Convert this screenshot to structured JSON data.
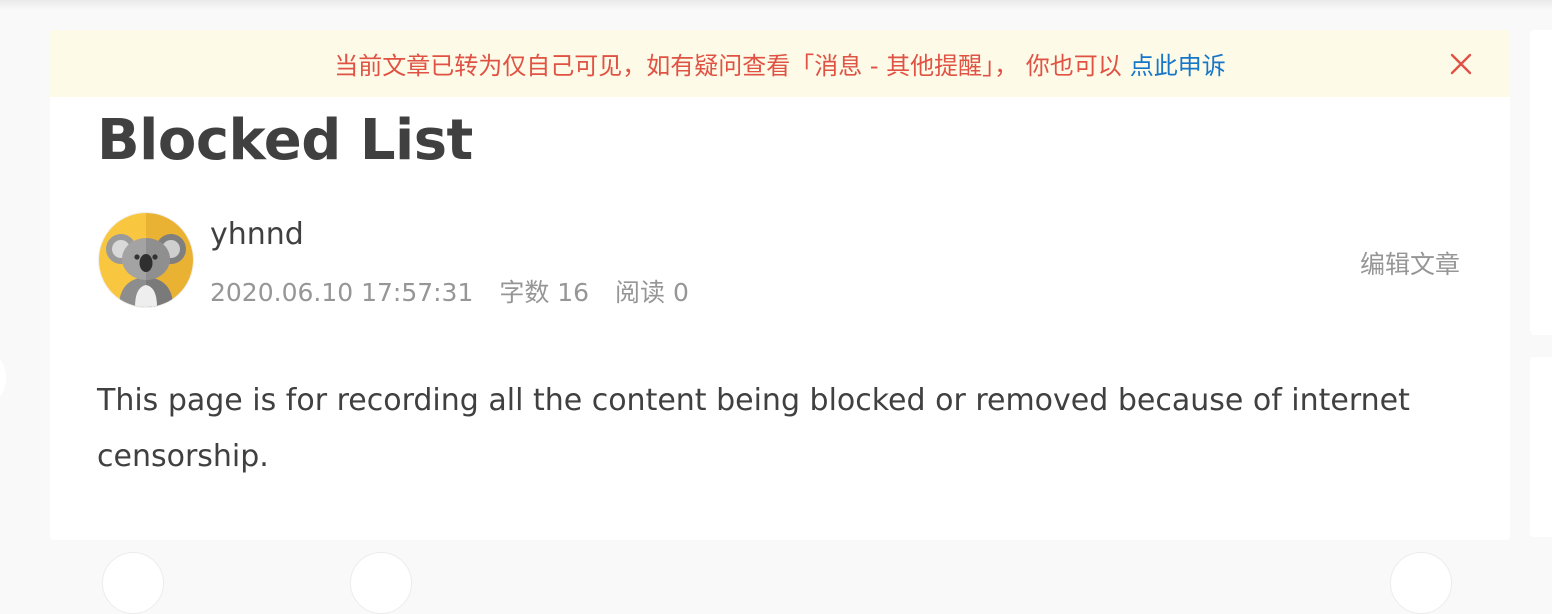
{
  "notice": {
    "message": "当前文章已转为仅自己可见，如有疑问查看「消息 - 其他提醒」， 你也可以",
    "appeal_link": "点此申诉",
    "close_icon": "close-icon"
  },
  "article": {
    "title": "Blocked List",
    "author": "yhnnd",
    "avatar_icon": "koala-avatar",
    "timestamp": "2020.06.10 17:57:31",
    "word_count": "字数 16",
    "read_count": "阅读 0",
    "edit_label": "编辑文章",
    "body": "This page is for recording all the content being blocked or removed because of internet censorship."
  },
  "colors": {
    "notice_bg": "#fdfae7",
    "notice_text": "#e05244",
    "link": "#1677c9",
    "meta_text": "#969696",
    "body_text": "#404040"
  }
}
